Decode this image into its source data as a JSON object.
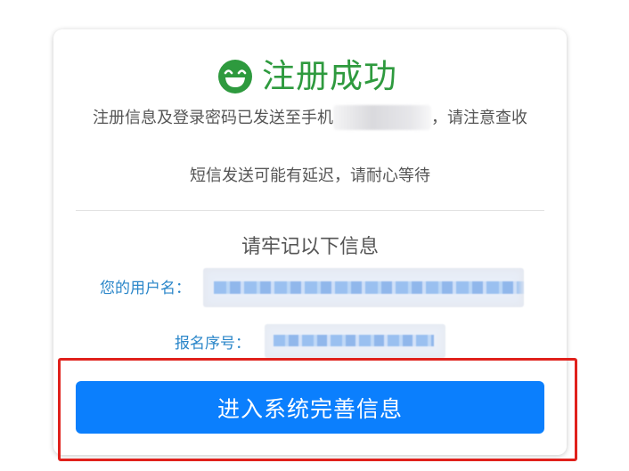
{
  "card": {
    "title": "注册成功",
    "title_icon": "smile-face-icon",
    "message_line1_prefix": "注册信息及登录密码已发送至手机",
    "message_line1_suffix": "，请注意查收",
    "message_line2": "短信发送可能有延迟，请耐心等待",
    "remember_heading": "请牢记以下信息",
    "username_label": "您的用户名：",
    "regnum_label": "报名序号：",
    "enter_button_label": "进入系统完善信息"
  },
  "colors": {
    "success_green": "#2e9a3e",
    "label_blue": "#2a86c9",
    "button_blue": "#0b7ffd",
    "highlight_red": "#e0211c"
  }
}
